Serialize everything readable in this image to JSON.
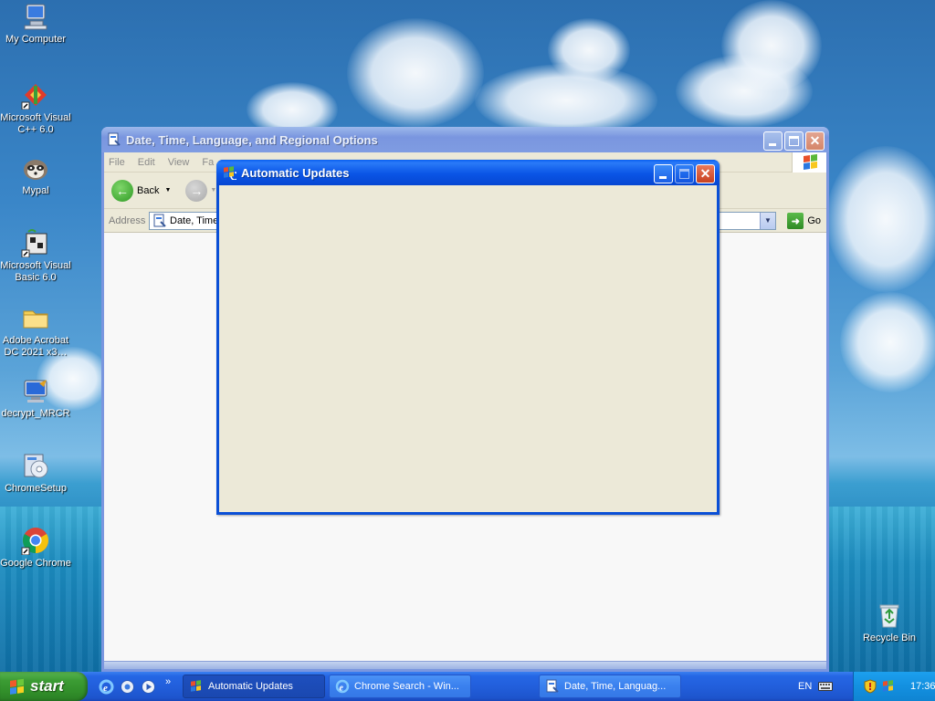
{
  "desktop": {
    "icons": [
      {
        "label": "My Computer"
      },
      {
        "label": "Microsoft Visual C++ 6.0"
      },
      {
        "label": "Mypal"
      },
      {
        "label": "Microsoft Visual Basic 6.0"
      },
      {
        "label": "Adobe Acrobat DC 2021 x3…"
      },
      {
        "label": "decrypt_MRCR"
      },
      {
        "label": "ChromeSetup"
      },
      {
        "label": "Google Chrome"
      },
      {
        "label": "Recycle Bin"
      }
    ]
  },
  "explorer": {
    "title": "Date, Time, Language, and Regional Options",
    "menu": [
      "File",
      "Edit",
      "View",
      "Fa"
    ],
    "toolbar": {
      "back_label": "Back"
    },
    "address": {
      "label": "Address",
      "value": "Date, Time",
      "go_label": "Go"
    }
  },
  "auto_updates": {
    "title": "Automatic Updates"
  },
  "taskbar": {
    "start_label": "start",
    "more_label": "»",
    "tasks": [
      {
        "label": "Automatic Updates"
      },
      {
        "label": "Chrome Search - Win..."
      },
      {
        "label": "Date, Time, Languag..."
      }
    ],
    "language": "EN",
    "clock": "17:36"
  },
  "colors": {
    "title_active": "#0a55e6",
    "title_inactive": "#7a96df",
    "window_face": "#ece9d8",
    "start_green": "#3c9c34",
    "taskbar_blue": "#225fdc",
    "tray_blue": "#1390e0"
  }
}
